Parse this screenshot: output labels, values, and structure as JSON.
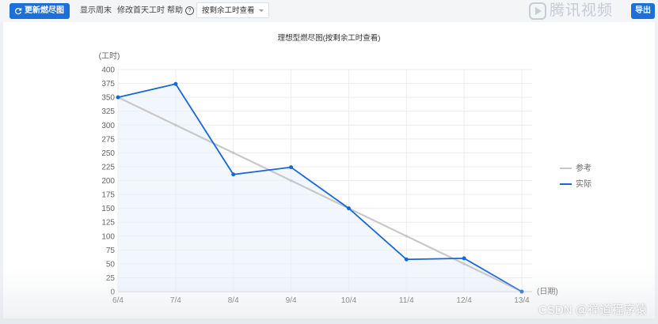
{
  "toolbar": {
    "refresh_label": "更新燃尽图",
    "show_weekend_label": "显示周末",
    "edit_first_day_label": "修改首天工时",
    "help_label": "帮助",
    "view_select_value": "按剩余工时查看",
    "export_label": "导出"
  },
  "watermark": {
    "text": "腾讯视频"
  },
  "footer": {
    "csdn_text": "CSDN @禅道程序猿"
  },
  "colors": {
    "accent": "#1f6fd8",
    "reference_line": "#c8c8c8",
    "actual_line": "#1767d6",
    "area_fill": "#eaf1fb"
  },
  "chart_data": {
    "type": "line",
    "title": "理想型燃尽图(按剩余工时查看)",
    "ylabel": "(工时)",
    "xlabel": "(日期)",
    "categories": [
      "6/4",
      "7/4",
      "8/4",
      "9/4",
      "10/4",
      "11/4",
      "12/4",
      "13/4"
    ],
    "ylim": [
      0,
      400
    ],
    "yticks": [
      0,
      25,
      50,
      75,
      100,
      125,
      150,
      175,
      200,
      225,
      250,
      275,
      300,
      325,
      350,
      375,
      400
    ],
    "grid": true,
    "legend_position": "right",
    "series": [
      {
        "name": "参考",
        "values": [
          350,
          300,
          250,
          200,
          150,
          100,
          50,
          0
        ]
      },
      {
        "name": "实际",
        "values": [
          350,
          374,
          211,
          224,
          150,
          58,
          60,
          0
        ]
      }
    ]
  }
}
